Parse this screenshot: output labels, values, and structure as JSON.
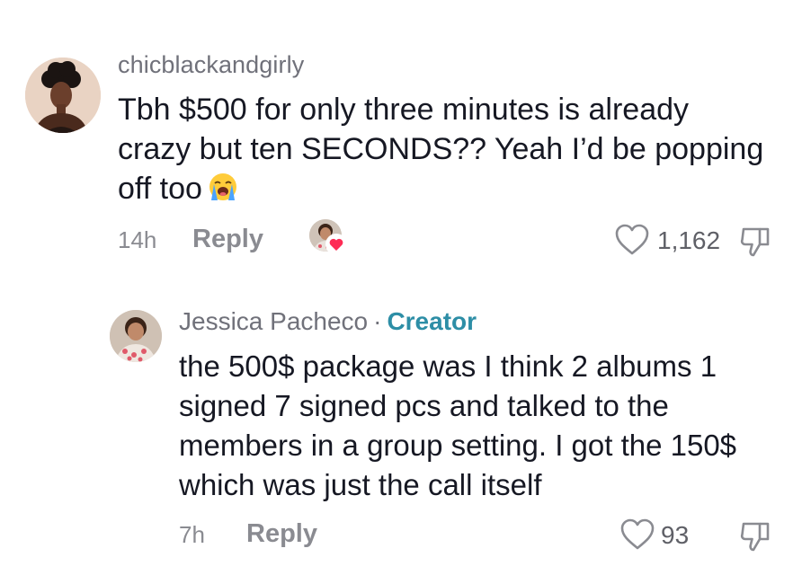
{
  "comments": [
    {
      "username": "chicblackandgirly",
      "text": "Tbh $500 for only three minutes is already crazy but ten SECONDS?? Yeah I’d be popping off too",
      "emoji": "loudly-crying-face",
      "time": "14h",
      "reply_label": "Reply",
      "creator_liked": true,
      "likes": "1,162"
    }
  ],
  "reply": {
    "username": "Jessica Pacheco",
    "separator": "·",
    "badge": "Creator",
    "text": "the 500$ package was I think 2 albums 1 signed 7 signed pcs and talked to the members in a group setting. I got the 150$ which was just the call itself",
    "time": "7h",
    "reply_label": "Reply",
    "likes": "93"
  },
  "icons": {
    "like": "heart-outline-icon",
    "dislike": "thumbs-down-icon",
    "creator_heart": "heart-badge-icon"
  },
  "colors": {
    "creator_badge": "#2d8ea6",
    "heart_badge": "#fe2c55",
    "muted_text": "#8a8b91"
  }
}
